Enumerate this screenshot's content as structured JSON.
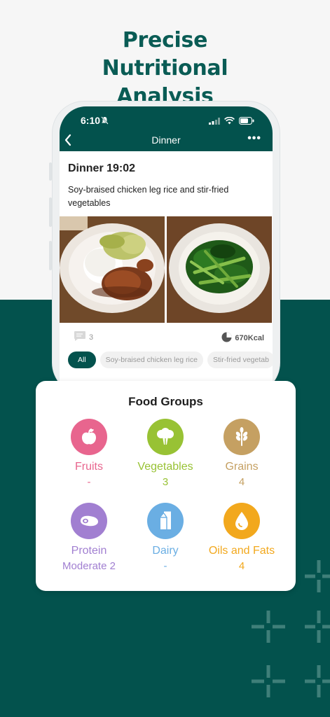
{
  "headline": "Precise Nutritional Analysis",
  "status_bar": {
    "time": "6:10"
  },
  "nav": {
    "title": "Dinner"
  },
  "meal": {
    "title": "Dinner 19:02",
    "description": "Soy-braised chicken leg rice and stir-fried vegetables",
    "comments": "3",
    "calories": "670Kcal"
  },
  "chips": [
    "All",
    "Soy-braised chicken leg rice",
    "Stir-fried vegetab"
  ],
  "food_groups": {
    "title": "Food Groups",
    "items": [
      {
        "label": "Fruits",
        "value": "-",
        "color": "#e8658e",
        "icon": "apple-icon"
      },
      {
        "label": "Vegetables",
        "value": "3",
        "color": "#98c234",
        "icon": "broccoli-icon"
      },
      {
        "label": "Grains",
        "value": "4",
        "color": "#c5a062",
        "icon": "wheat-icon"
      },
      {
        "label": "Protein",
        "value": "Moderate 2",
        "color": "#a17fd1",
        "icon": "meat-icon"
      },
      {
        "label": "Dairy",
        "value": "-",
        "color": "#6aaee3",
        "icon": "milk-carton-icon"
      },
      {
        "label": "Oils and Fats",
        "value": "4",
        "color": "#f2a81d",
        "icon": "oil-drop-icon"
      }
    ]
  }
}
